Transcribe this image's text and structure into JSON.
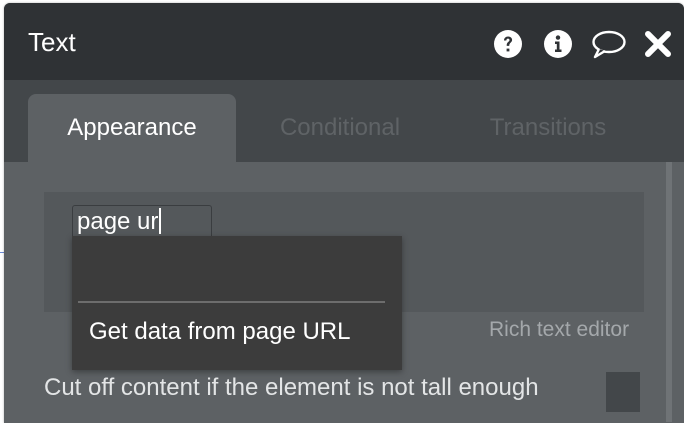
{
  "panel": {
    "title": "Text",
    "header_icons": [
      {
        "name": "help-icon"
      },
      {
        "name": "info-icon"
      },
      {
        "name": "comment-icon"
      },
      {
        "name": "close-icon"
      }
    ]
  },
  "tabs": [
    {
      "label": "Appearance",
      "active": true
    },
    {
      "label": "Conditional",
      "active": false
    },
    {
      "label": "Transitions",
      "active": false
    }
  ],
  "editor": {
    "input_value": "page ur",
    "rich_text_label": "Rich text editor"
  },
  "dropdown": {
    "options": [
      "Get data from page URL"
    ]
  },
  "options": {
    "cutoff_label": "Cut off content if the element is not tall enough"
  },
  "colors": {
    "header_bg": "#2f3235",
    "panel_bg": "#5d6164",
    "dropdown_bg": "#3c3c3c"
  }
}
